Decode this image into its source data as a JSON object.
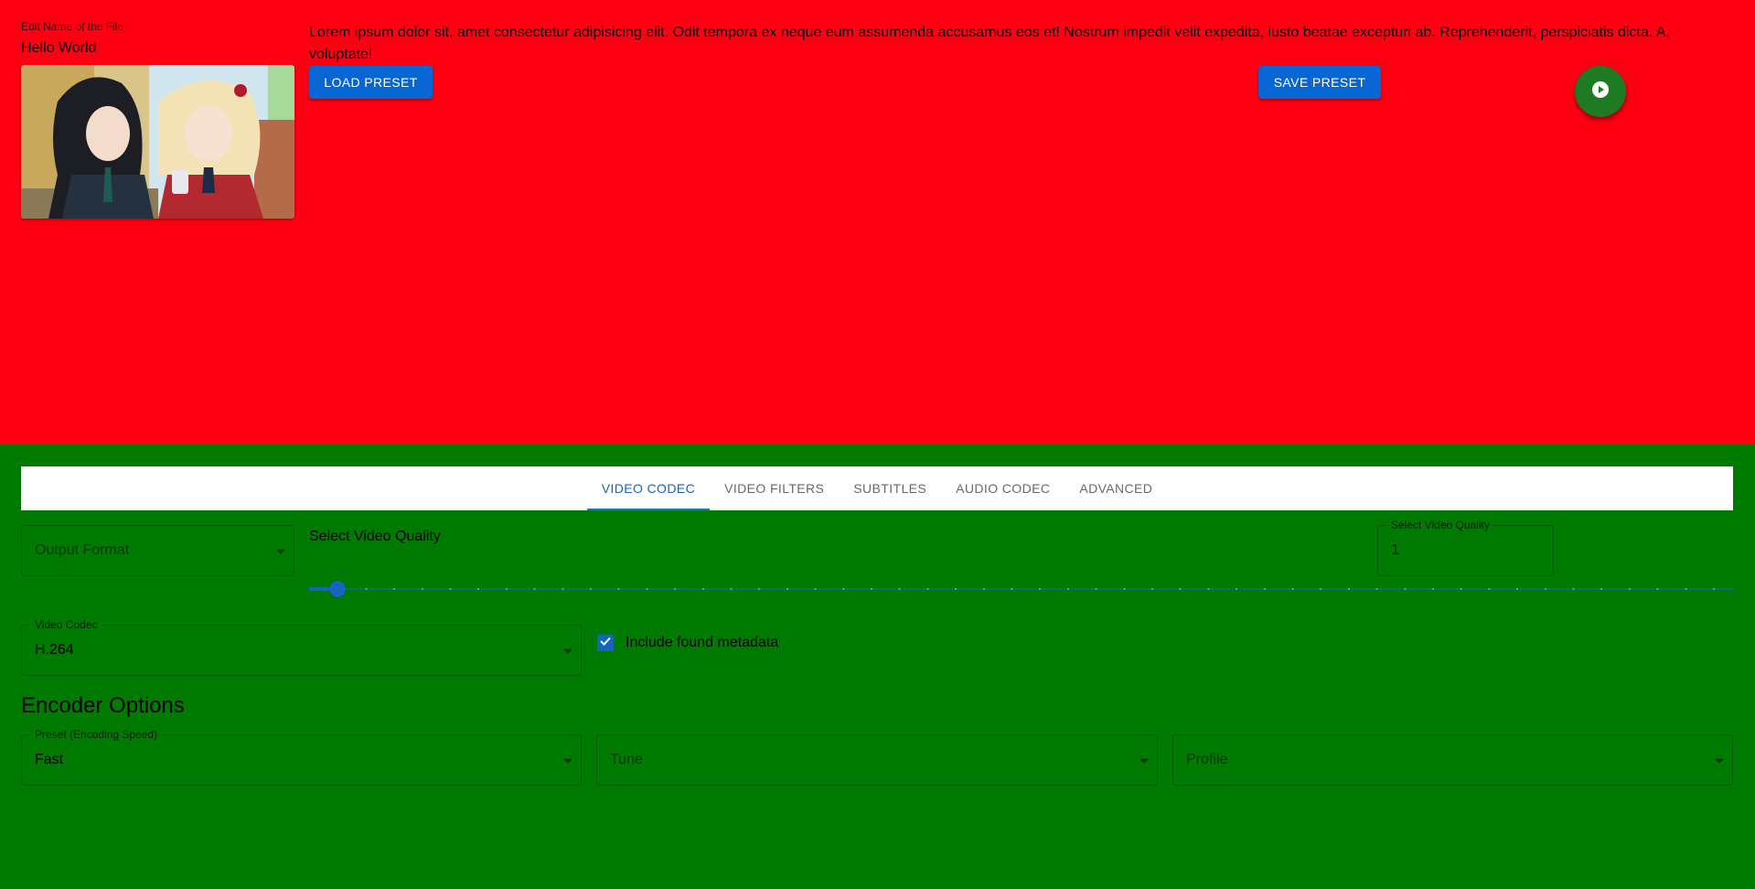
{
  "header": {
    "file_label": "Edit Name of the File",
    "file_name": "Hello World",
    "description": "Lorem ipsum dolor sit, amet consectetur adipisicing elit. Odit tempora ex neque eum assumenda accusamus eos et! Nostrum impedit velit expedita, iusto beatae excepturi ab. Reprehenderit, perspiciatis dicta. A, voluptate!",
    "load_preset_label": "Load Preset",
    "save_preset_label": "Save Preset",
    "run_icon": "play-circle-icon"
  },
  "tabs": [
    {
      "label": "Video Codec",
      "active": true
    },
    {
      "label": "Video Filters",
      "active": false
    },
    {
      "label": "Subtitles",
      "active": false
    },
    {
      "label": "Audio Codec",
      "active": false
    },
    {
      "label": "Advanced",
      "active": false
    }
  ],
  "video_codec": {
    "output_format_placeholder": "Output Format",
    "quality_title": "Select Video Quality",
    "quality_input_label": "Select Video Quality",
    "quality_value": "1",
    "quality_slider": {
      "value": 1,
      "min": 0,
      "max": 51
    },
    "codec_label": "Video Codec",
    "codec_value": "H.264",
    "metadata_label": "Include found metadata",
    "metadata_checked": true,
    "encoder_options_title": "Encoder Options",
    "preset_label": "Preset (Encoding Speed)",
    "preset_value": "Fast",
    "tune_placeholder": "Tune",
    "profile_placeholder": "Profile"
  },
  "colors": {
    "top_bg": "#ff0012",
    "bottom_bg": "#007a00",
    "primary": "#0866d4",
    "fab": "#1f7a24"
  }
}
